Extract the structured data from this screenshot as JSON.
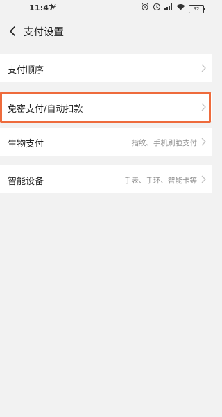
{
  "status_bar": {
    "time": "11:47",
    "left_indicator": "ꕤ",
    "battery": "92",
    "icons": [
      "alarm-icon",
      "vibrate-icon",
      "signal-icon",
      "wifi-icon",
      "battery-icon"
    ]
  },
  "header": {
    "title": "支付设置"
  },
  "items": [
    {
      "label": "支付顺序",
      "sub": ""
    },
    {
      "label": "免密支付/自动扣款",
      "sub": ""
    },
    {
      "label": "生物支付",
      "sub": "指纹、手机刷脸支付"
    },
    {
      "label": "智能设备",
      "sub": "手表、手环、智能卡等"
    }
  ],
  "colors": {
    "background": "#f2f2f2",
    "card": "#ffffff",
    "highlight": "#ee6b3c",
    "subtext": "#8e8e8e"
  }
}
